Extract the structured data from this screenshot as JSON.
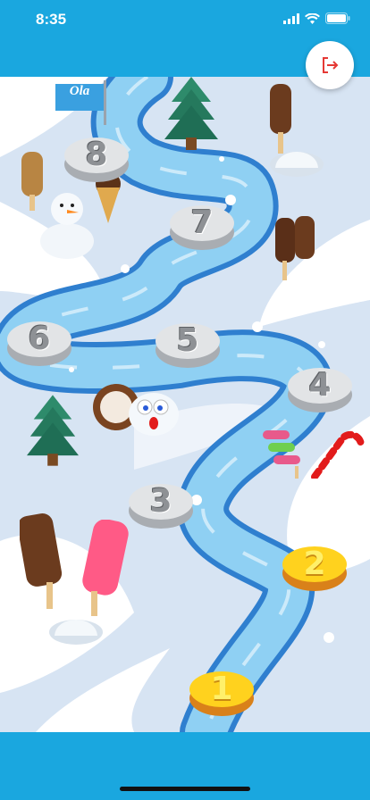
{
  "status_bar": {
    "time": "8:35"
  },
  "exit_button": {
    "icon": "exit-icon",
    "color": "#e53935"
  },
  "brand_flag": {
    "text": "Ola"
  },
  "colors": {
    "bar": "#1aa7df",
    "unlocked": "#ffd21e",
    "locked": "#e2e4e6"
  },
  "levels": [
    {
      "number": "1",
      "state": "unlocked"
    },
    {
      "number": "2",
      "state": "unlocked"
    },
    {
      "number": "3",
      "state": "locked"
    },
    {
      "number": "4",
      "state": "locked"
    },
    {
      "number": "5",
      "state": "locked"
    },
    {
      "number": "6",
      "state": "locked"
    },
    {
      "number": "7",
      "state": "locked"
    },
    {
      "number": "8",
      "state": "locked"
    }
  ]
}
